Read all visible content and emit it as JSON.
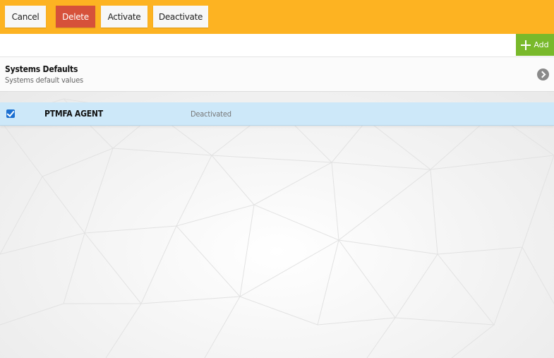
{
  "toolbar": {
    "cancel_label": "Cancel",
    "delete_label": "Delete",
    "activate_label": "Activate",
    "deactivate_label": "Deactivate",
    "background_color": "#fdb322",
    "delete_color": "#d6513a"
  },
  "addbar": {
    "add_label": "Add",
    "add_icon": "plus-icon",
    "add_color": "#79b92b"
  },
  "section": {
    "title": "Systems Defaults",
    "subtitle": "Systems default values",
    "nav_icon": "chevron-right-circle-icon"
  },
  "rows": [
    {
      "name": "PTMFA AGENT",
      "status": "Deactivated",
      "checked": true,
      "highlight_color": "#cde8f9"
    }
  ]
}
